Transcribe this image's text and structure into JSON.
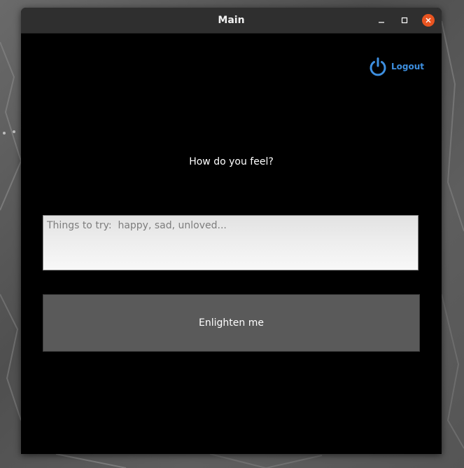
{
  "window": {
    "title": "Main"
  },
  "header": {
    "logout_label": "Logout",
    "logout_icon": "power-icon"
  },
  "main": {
    "question": "How do you feel?",
    "feeling_input": {
      "value": "",
      "placeholder": "Things to try:  happy, sad, unloved..."
    },
    "enlighten_label": "Enlighten me"
  },
  "colors": {
    "accent": "#3d8fe0",
    "close_button": "#e95420",
    "titlebar": "#2f2f2f",
    "button_bg": "#5a5a5a"
  }
}
